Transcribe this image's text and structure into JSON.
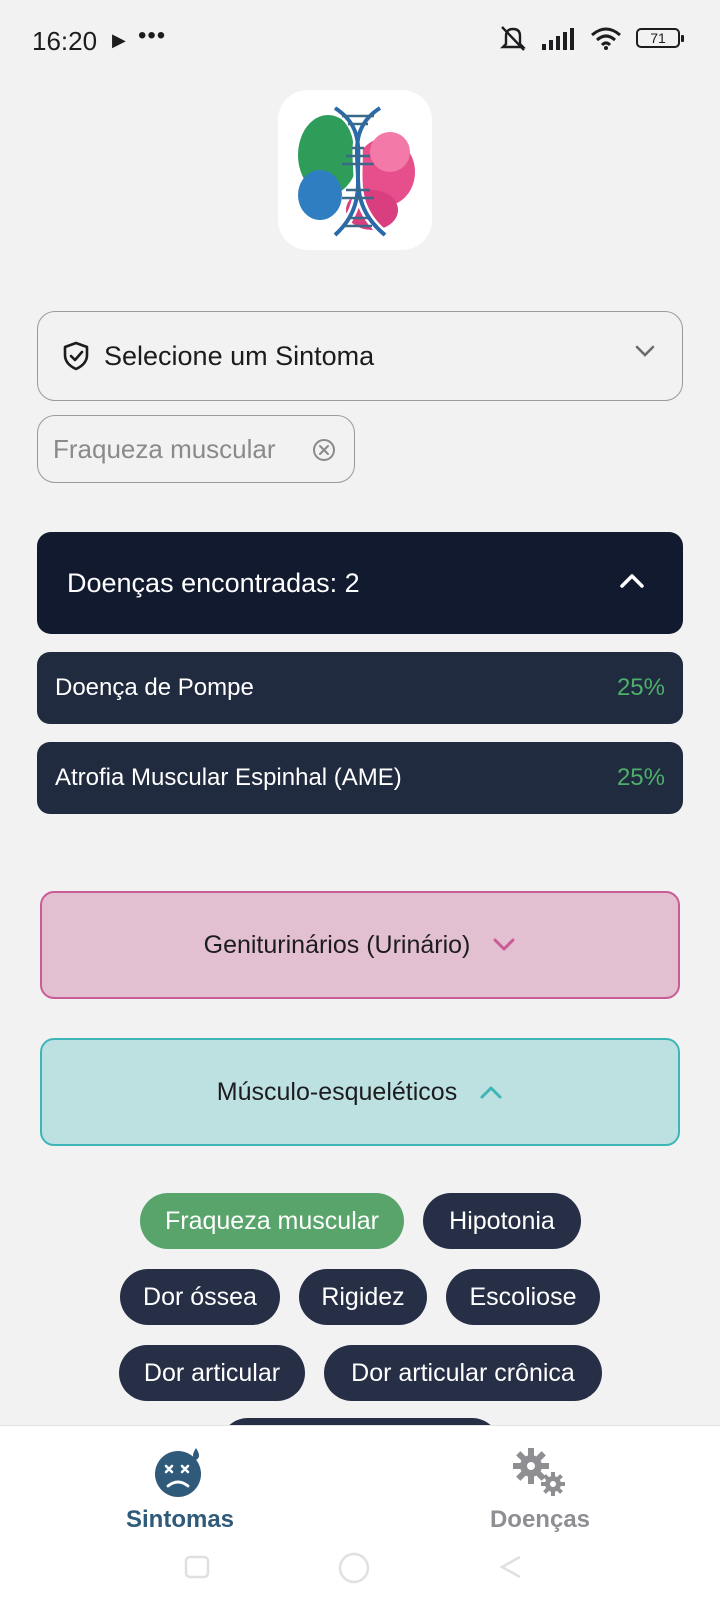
{
  "status_bar": {
    "time": "16:20",
    "play_glyph": "▶",
    "dots": "•••",
    "battery": "71"
  },
  "app": {
    "logo_icon": "dna-logo-icon"
  },
  "symptom_select": {
    "placeholder": "Selecione um Sintoma",
    "icon": "shield-check-icon"
  },
  "selected_symptom": {
    "label": "Fraqueza muscular"
  },
  "results": {
    "title": "Doenças encontradas: 2",
    "items": [
      {
        "name": "Doença de Pompe",
        "percent": "25%"
      },
      {
        "name": "Atrofia Muscular Espinhal (AME)",
        "percent": "25%"
      }
    ]
  },
  "categories": [
    {
      "label": "Geniturinários (Urinário)",
      "expanded": false,
      "color": "#c95c94"
    },
    {
      "label": "Músculo-esqueléticos",
      "expanded": true,
      "color": "#3eb6b8"
    }
  ],
  "symptoms": [
    {
      "label": "Fraqueza muscular",
      "active": true
    },
    {
      "label": "Hipotonia",
      "active": false
    },
    {
      "label": "Dor óssea",
      "active": false
    },
    {
      "label": "Rigidez",
      "active": false
    },
    {
      "label": "Escoliose",
      "active": false
    },
    {
      "label": "Dor articular",
      "active": false
    },
    {
      "label": "Dor articular crônica",
      "active": false
    }
  ],
  "bottom_nav": {
    "items": [
      {
        "label": "Sintomas",
        "icon": "sick-face-icon",
        "active": true
      },
      {
        "label": "Doenças",
        "icon": "gears-icon",
        "active": false
      }
    ]
  },
  "colors": {
    "accent_dark": "#111a2e",
    "pill_dark": "#272f47",
    "success": "#58a46b",
    "nav_active": "#2f5a79",
    "nav_inactive": "#8e8e93"
  }
}
